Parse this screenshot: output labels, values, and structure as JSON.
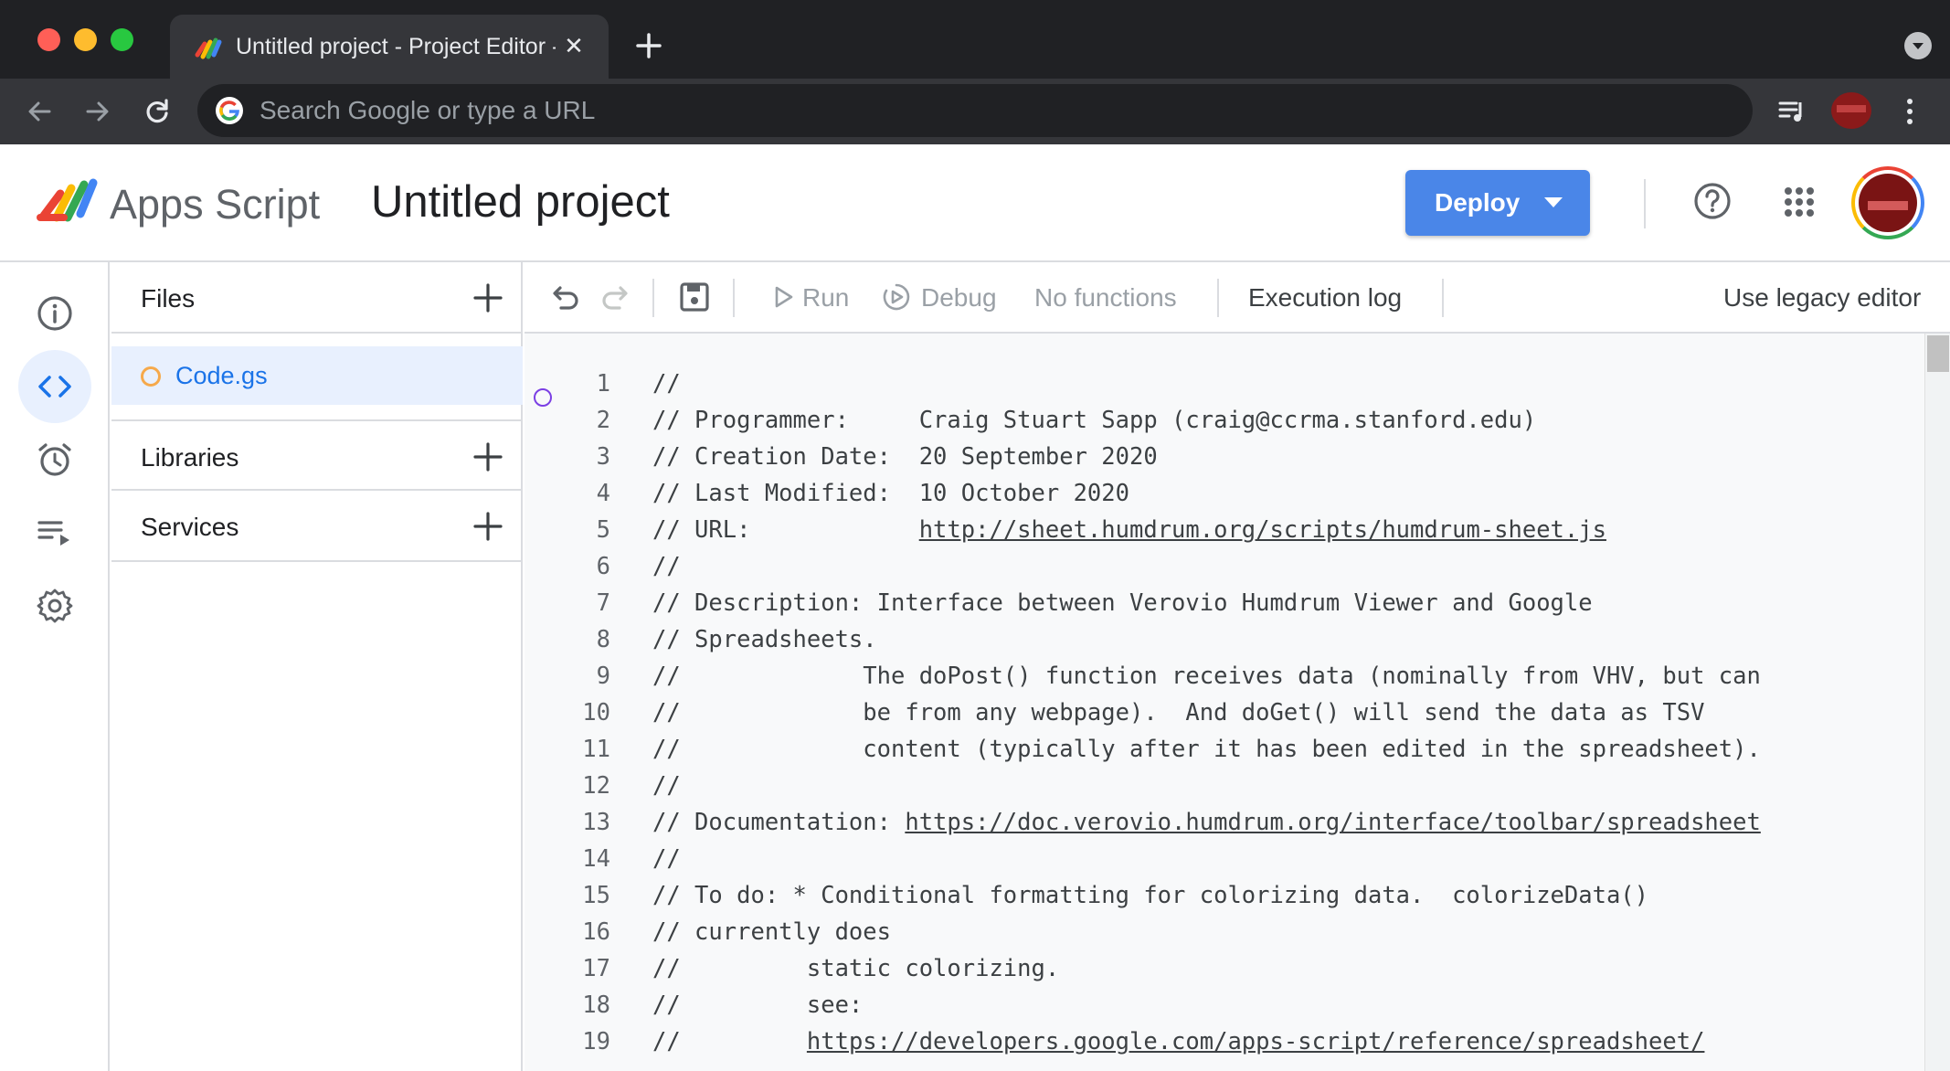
{
  "browser": {
    "tab_title": "Untitled project - Project Editor - Apps Script",
    "omnibox_placeholder": "Search Google or type a URL"
  },
  "header": {
    "product_name": "Apps Script",
    "project_title": "Untitled project",
    "deploy_label": "Deploy"
  },
  "colors": {
    "accent": "#4a86e8",
    "selected_bg": "#e8f0fe",
    "link": "#1a73e8"
  },
  "rail": {
    "items": [
      "overview-icon",
      "editor-icon",
      "triggers-icon",
      "executions-icon",
      "settings-icon"
    ],
    "active": "editor"
  },
  "files_panel": {
    "files_label": "Files",
    "files": [
      "Code.gs"
    ],
    "libraries_label": "Libraries",
    "services_label": "Services"
  },
  "toolbar": {
    "run_label": "Run",
    "debug_label": "Debug",
    "function_select": "No functions",
    "execution_log_label": "Execution log",
    "legacy_label": "Use legacy editor"
  },
  "code": {
    "lines": [
      {
        "n": "1",
        "pre": "//",
        "link": "",
        "post": ""
      },
      {
        "n": "2",
        "pre": "// Programmer:     Craig Stuart Sapp (craig@ccrma.stanford.edu)",
        "link": "",
        "post": ""
      },
      {
        "n": "3",
        "pre": "// Creation Date:  20 September 2020",
        "link": "",
        "post": ""
      },
      {
        "n": "4",
        "pre": "// Last Modified:  10 October 2020",
        "link": "",
        "post": ""
      },
      {
        "n": "5",
        "pre": "// URL:            ",
        "link": "http://sheet.humdrum.org/scripts/humdrum-sheet.js",
        "post": ""
      },
      {
        "n": "6",
        "pre": "//",
        "link": "",
        "post": ""
      },
      {
        "n": "7",
        "pre": "// Description: Interface between Verovio Humdrum Viewer and Google",
        "link": "",
        "post": ""
      },
      {
        "n": "8",
        "pre": "// Spreadsheets.",
        "link": "",
        "post": ""
      },
      {
        "n": "9",
        "pre": "//             The doPost() function receives data (nominally from VHV, but can",
        "link": "",
        "post": ""
      },
      {
        "n": "10",
        "pre": "//             be from any webpage).  And doGet() will send the data as TSV",
        "link": "",
        "post": ""
      },
      {
        "n": "11",
        "pre": "//             content (typically after it has been edited in the spreadsheet).",
        "link": "",
        "post": ""
      },
      {
        "n": "12",
        "pre": "//",
        "link": "",
        "post": ""
      },
      {
        "n": "13",
        "pre": "// Documentation: ",
        "link": "https://doc.verovio.humdrum.org/interface/toolbar/spreadsheet",
        "post": ""
      },
      {
        "n": "14",
        "pre": "//",
        "link": "",
        "post": ""
      },
      {
        "n": "15",
        "pre": "// To do: * Conditional formatting for colorizing data.  colorizeData()",
        "link": "",
        "post": ""
      },
      {
        "n": "16",
        "pre": "// currently does",
        "link": "",
        "post": ""
      },
      {
        "n": "17",
        "pre": "//         static colorizing.",
        "link": "",
        "post": ""
      },
      {
        "n": "18",
        "pre": "//         see:",
        "link": "",
        "post": ""
      },
      {
        "n": "19",
        "pre": "//         ",
        "link": "https://developers.google.com/apps-script/reference/spreadsheet/",
        "post": ""
      }
    ]
  }
}
